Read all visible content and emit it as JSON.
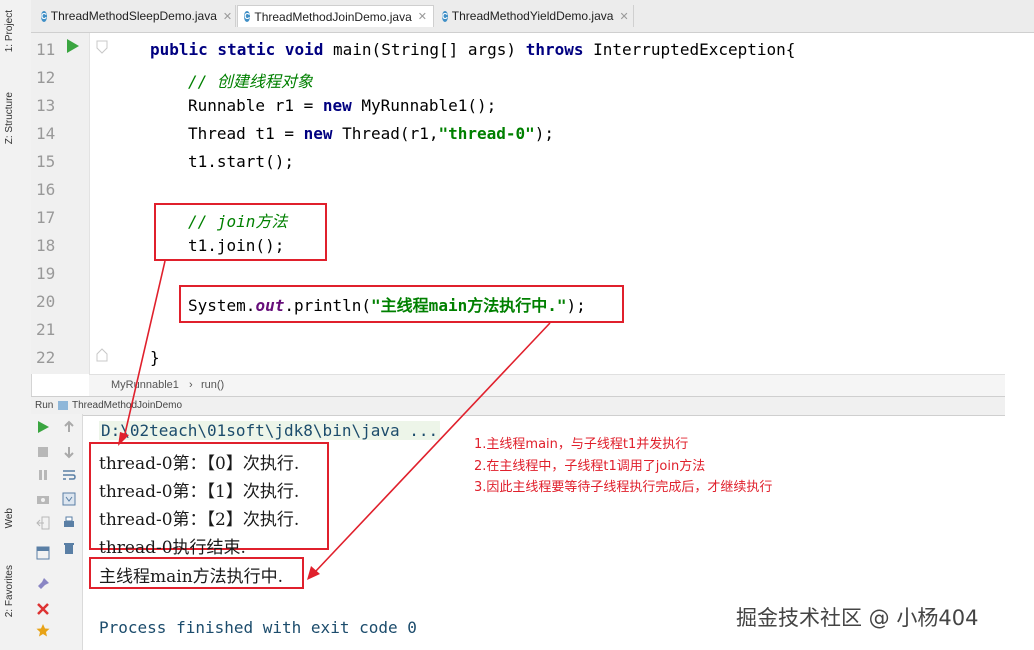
{
  "left_strip": {
    "project_tab": "1: Project",
    "structure_tab": "Z: Structure",
    "web_tab": "Web",
    "favorites_tab": "2: Favorites"
  },
  "tabs": [
    {
      "label": "ThreadMethodSleepDemo.java",
      "active": false
    },
    {
      "label": "ThreadMethodJoinDemo.java",
      "active": true
    },
    {
      "label": "ThreadMethodYieldDemo.java",
      "active": false
    }
  ],
  "editor": {
    "line_numbers": [
      "11",
      "12",
      "13",
      "14",
      "15",
      "16",
      "17",
      "18",
      "19",
      "20",
      "21",
      "22"
    ],
    "lines": {
      "l11_kw1": "public static void",
      "l11_main": " main(String[] args) ",
      "l11_kw2": "throws",
      "l11_rest": " InterruptedException{",
      "l12": "// 创建线程对象",
      "l13_a": "Runnable r1 = ",
      "l13_kw": "new",
      "l13_b": " MyRunnable1();",
      "l14_a": "Thread t1 = ",
      "l14_kw": "new",
      "l14_b": " Thread(r1,",
      "l14_str": "\"thread-0\"",
      "l14_c": ");",
      "l15": "t1.start();",
      "l17": "// join方法",
      "l18": "t1.join();",
      "l20_a": "System.",
      "l20_fld": "out",
      "l20_b": ".println(",
      "l20_str": "\"主线程main方法执行中.\"",
      "l20_c": ");",
      "l22": "}"
    }
  },
  "breadcrumb": {
    "item1": "MyRunnable1",
    "sep": "›",
    "item2": "run()"
  },
  "run_panel": {
    "label": "Run",
    "config": "ThreadMethodJoinDemo",
    "cmd_line": "D:\\02teach\\01soft\\jdk8\\bin\\java ...",
    "output": [
      "thread-0第：【0】次执行.",
      "thread-0第：【1】次执行.",
      "thread-0第：【2】次执行.",
      "thread-0执行结束."
    ],
    "main_output": "主线程main方法执行中.",
    "finished": "Process finished with exit code 0"
  },
  "annotations": [
    "1.主线程main，与子线程t1并发执行",
    "2.在主线程中，子线程t1调用了join方法",
    "3.因此主线程要等待子线程执行完成后，才继续执行"
  ],
  "watermark": "掘金技术社区 @ 小杨404",
  "colors": {
    "annotation": "#e0202c",
    "keyword": "#000080",
    "string": "#008000"
  }
}
